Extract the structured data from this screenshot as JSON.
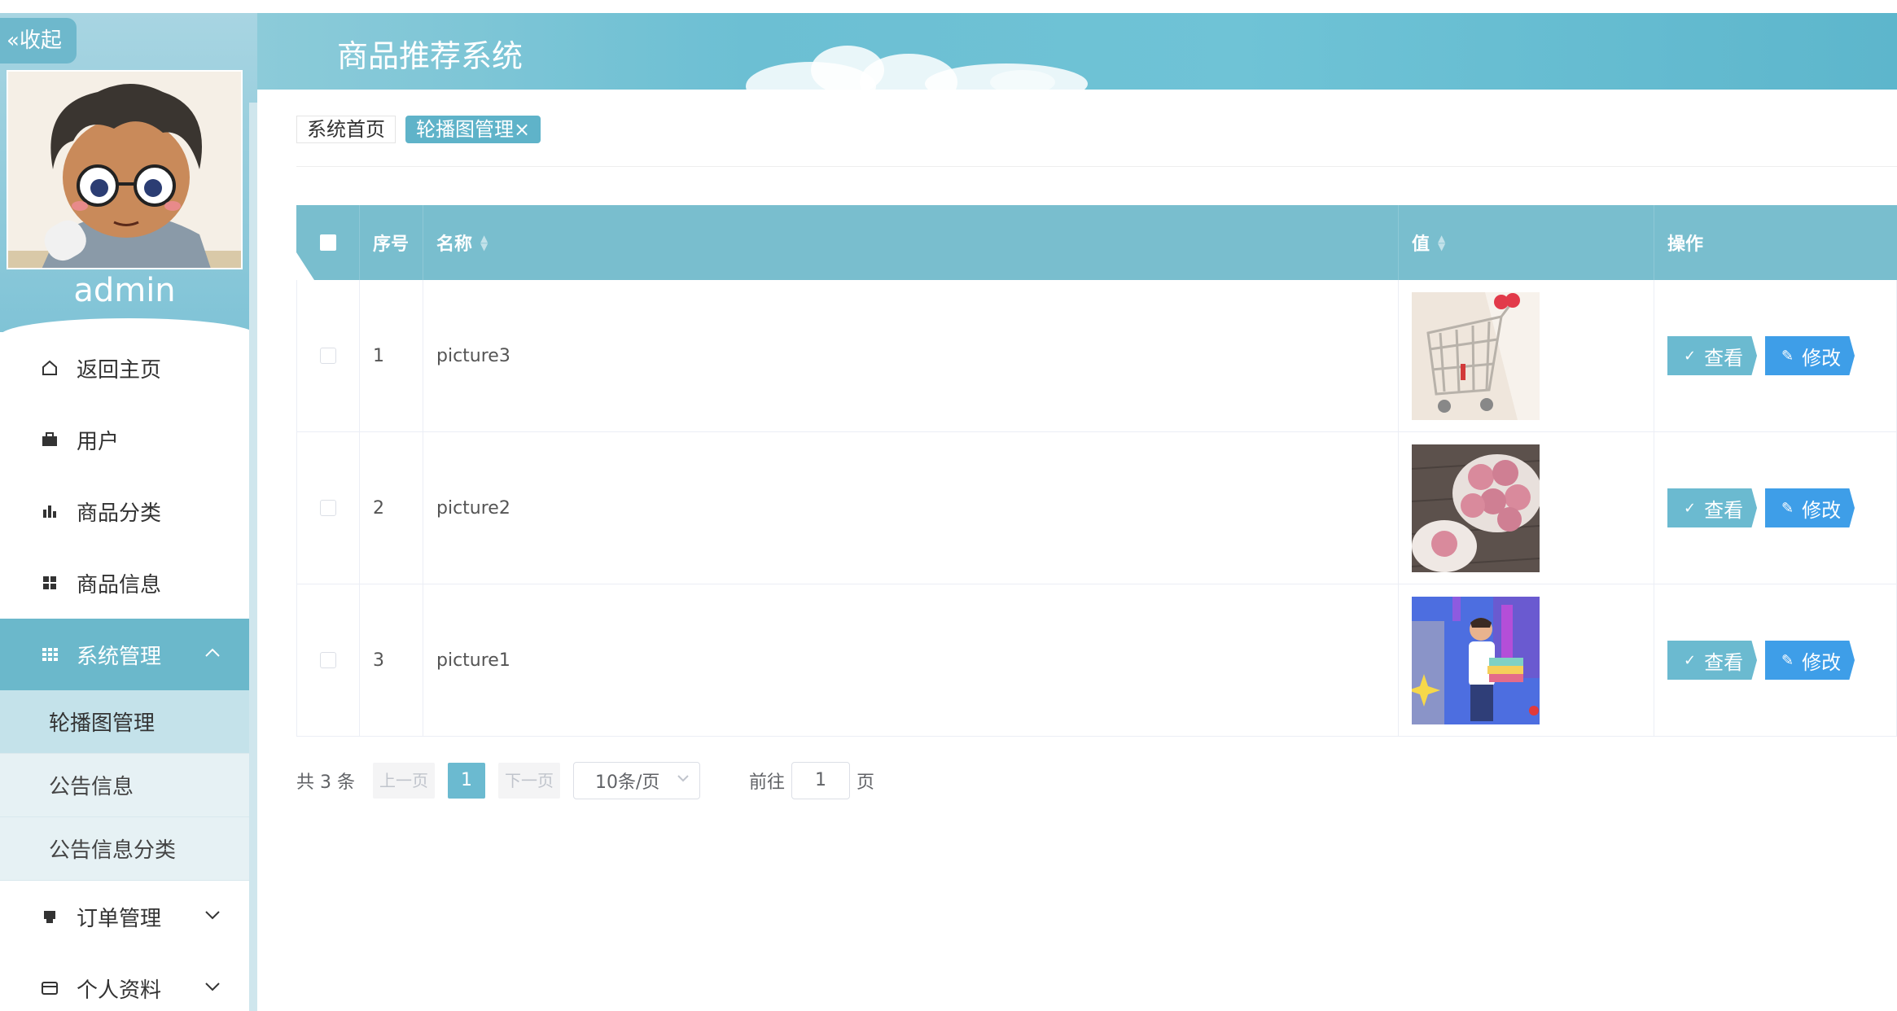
{
  "header": {
    "title": "商品推荐系统"
  },
  "sidebar": {
    "collapse_label": "收起",
    "username": "admin",
    "items": [
      {
        "label": "返回主页",
        "icon": "home-icon"
      },
      {
        "label": "用户",
        "icon": "briefcase-icon"
      },
      {
        "label": "商品分类",
        "icon": "bar-chart-icon"
      },
      {
        "label": "商品信息",
        "icon": "grid-icon"
      },
      {
        "label": "系统管理",
        "icon": "apps-icon",
        "expanded": true
      },
      {
        "label": "订单管理",
        "icon": "printer-icon"
      },
      {
        "label": "个人资料",
        "icon": "card-icon"
      }
    ],
    "subitems": [
      {
        "label": "轮播图管理",
        "active": true
      },
      {
        "label": "公告信息"
      },
      {
        "label": "公告信息分类"
      }
    ]
  },
  "tabs": [
    {
      "label": "系统首页"
    },
    {
      "label": "轮播图管理",
      "close": "×"
    }
  ],
  "table": {
    "headers": {
      "index": "序号",
      "name": "名称",
      "value": "值",
      "actions": "操作"
    },
    "rows": [
      {
        "index": "1",
        "name": "picture3",
        "image": "shopping-cart-thumbnail"
      },
      {
        "index": "2",
        "name": "picture2",
        "image": "pink-cookies-thumbnail"
      },
      {
        "index": "3",
        "name": "picture1",
        "image": "shopper-illustration-thumbnail"
      }
    ],
    "view_label": "查看",
    "edit_label": "修改"
  },
  "pagination": {
    "total": "共 3 条",
    "prev": "上一页",
    "current": "1",
    "next": "下一页",
    "page_size": "10条/页",
    "goto_label": "前往",
    "goto_value": "1",
    "page_suffix": "页"
  },
  "colors": {
    "accent": "#6bbad0",
    "edit": "#3e9ee8",
    "header": "#79bece"
  }
}
